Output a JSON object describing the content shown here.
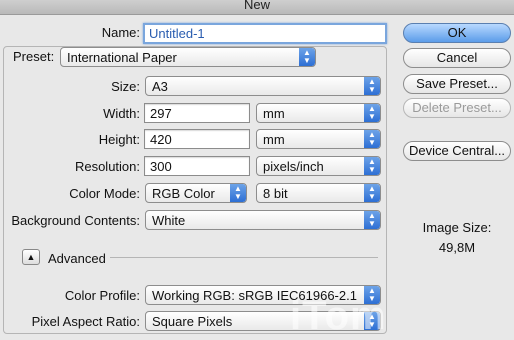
{
  "window": {
    "title": "New"
  },
  "form": {
    "name_label": "Name:",
    "name_value": "Untitled-1",
    "preset_label": "Preset:",
    "preset_value": "International Paper",
    "size_label": "Size:",
    "size_value": "A3",
    "width_label": "Width:",
    "width_value": "297",
    "width_unit": "mm",
    "height_label": "Height:",
    "height_value": "420",
    "height_unit": "mm",
    "resolution_label": "Resolution:",
    "resolution_value": "300",
    "resolution_unit": "pixels/inch",
    "color_mode_label": "Color Mode:",
    "color_mode_value": "RGB Color",
    "bit_depth_value": "8 bit",
    "background_label": "Background Contents:",
    "background_value": "White",
    "advanced_label": "Advanced",
    "color_profile_label": "Color Profile:",
    "color_profile_value": "Working RGB:  sRGB IEC61966-2.1",
    "pixel_aspect_label": "Pixel Aspect Ratio:",
    "pixel_aspect_value": "Square Pixels"
  },
  "buttons": {
    "ok": "OK",
    "cancel": "Cancel",
    "save_preset": "Save Preset...",
    "delete_preset": "Delete Preset...",
    "device_central": "Device Central..."
  },
  "info": {
    "image_size_label": "Image Size:",
    "image_size_value": "49,8M"
  },
  "watermark": "iTom",
  "colors": {
    "accent": "#2d6fd4",
    "default_button": "#5b9ce9",
    "focus_ring": "#7aa6dd"
  }
}
